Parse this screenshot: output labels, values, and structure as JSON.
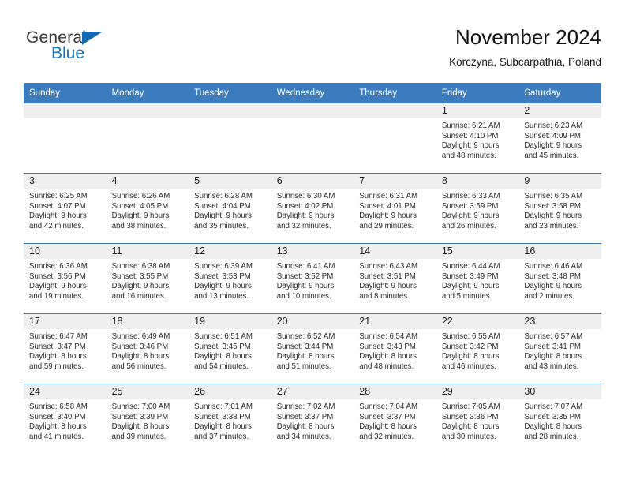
{
  "brand": {
    "name_part1": "General",
    "name_part2": "Blue",
    "triangle_icon": "triangle-icon",
    "accent_blue": "#1577c4"
  },
  "header": {
    "title": "November 2024",
    "subtitle": "Korczyna, Subcarpathia, Poland"
  },
  "theme": {
    "header_bar_color": "#3b7cbe",
    "daynum_band_color": "#efefef",
    "row_divider_color": "#3b7cbe"
  },
  "weekday_headers": [
    "Sunday",
    "Monday",
    "Tuesday",
    "Wednesday",
    "Thursday",
    "Friday",
    "Saturday"
  ],
  "weeks": [
    [
      {
        "day": "",
        "sunrise": "",
        "sunset": "",
        "daylight_a": "",
        "daylight_b": ""
      },
      {
        "day": "",
        "sunrise": "",
        "sunset": "",
        "daylight_a": "",
        "daylight_b": ""
      },
      {
        "day": "",
        "sunrise": "",
        "sunset": "",
        "daylight_a": "",
        "daylight_b": ""
      },
      {
        "day": "",
        "sunrise": "",
        "sunset": "",
        "daylight_a": "",
        "daylight_b": ""
      },
      {
        "day": "",
        "sunrise": "",
        "sunset": "",
        "daylight_a": "",
        "daylight_b": ""
      },
      {
        "day": "1",
        "sunrise": "Sunrise: 6:21 AM",
        "sunset": "Sunset: 4:10 PM",
        "daylight_a": "Daylight: 9 hours",
        "daylight_b": "and 48 minutes."
      },
      {
        "day": "2",
        "sunrise": "Sunrise: 6:23 AM",
        "sunset": "Sunset: 4:09 PM",
        "daylight_a": "Daylight: 9 hours",
        "daylight_b": "and 45 minutes."
      }
    ],
    [
      {
        "day": "3",
        "sunrise": "Sunrise: 6:25 AM",
        "sunset": "Sunset: 4:07 PM",
        "daylight_a": "Daylight: 9 hours",
        "daylight_b": "and 42 minutes."
      },
      {
        "day": "4",
        "sunrise": "Sunrise: 6:26 AM",
        "sunset": "Sunset: 4:05 PM",
        "daylight_a": "Daylight: 9 hours",
        "daylight_b": "and 38 minutes."
      },
      {
        "day": "5",
        "sunrise": "Sunrise: 6:28 AM",
        "sunset": "Sunset: 4:04 PM",
        "daylight_a": "Daylight: 9 hours",
        "daylight_b": "and 35 minutes."
      },
      {
        "day": "6",
        "sunrise": "Sunrise: 6:30 AM",
        "sunset": "Sunset: 4:02 PM",
        "daylight_a": "Daylight: 9 hours",
        "daylight_b": "and 32 minutes."
      },
      {
        "day": "7",
        "sunrise": "Sunrise: 6:31 AM",
        "sunset": "Sunset: 4:01 PM",
        "daylight_a": "Daylight: 9 hours",
        "daylight_b": "and 29 minutes."
      },
      {
        "day": "8",
        "sunrise": "Sunrise: 6:33 AM",
        "sunset": "Sunset: 3:59 PM",
        "daylight_a": "Daylight: 9 hours",
        "daylight_b": "and 26 minutes."
      },
      {
        "day": "9",
        "sunrise": "Sunrise: 6:35 AM",
        "sunset": "Sunset: 3:58 PM",
        "daylight_a": "Daylight: 9 hours",
        "daylight_b": "and 23 minutes."
      }
    ],
    [
      {
        "day": "10",
        "sunrise": "Sunrise: 6:36 AM",
        "sunset": "Sunset: 3:56 PM",
        "daylight_a": "Daylight: 9 hours",
        "daylight_b": "and 19 minutes."
      },
      {
        "day": "11",
        "sunrise": "Sunrise: 6:38 AM",
        "sunset": "Sunset: 3:55 PM",
        "daylight_a": "Daylight: 9 hours",
        "daylight_b": "and 16 minutes."
      },
      {
        "day": "12",
        "sunrise": "Sunrise: 6:39 AM",
        "sunset": "Sunset: 3:53 PM",
        "daylight_a": "Daylight: 9 hours",
        "daylight_b": "and 13 minutes."
      },
      {
        "day": "13",
        "sunrise": "Sunrise: 6:41 AM",
        "sunset": "Sunset: 3:52 PM",
        "daylight_a": "Daylight: 9 hours",
        "daylight_b": "and 10 minutes."
      },
      {
        "day": "14",
        "sunrise": "Sunrise: 6:43 AM",
        "sunset": "Sunset: 3:51 PM",
        "daylight_a": "Daylight: 9 hours",
        "daylight_b": "and 8 minutes."
      },
      {
        "day": "15",
        "sunrise": "Sunrise: 6:44 AM",
        "sunset": "Sunset: 3:49 PM",
        "daylight_a": "Daylight: 9 hours",
        "daylight_b": "and 5 minutes."
      },
      {
        "day": "16",
        "sunrise": "Sunrise: 6:46 AM",
        "sunset": "Sunset: 3:48 PM",
        "daylight_a": "Daylight: 9 hours",
        "daylight_b": "and 2 minutes."
      }
    ],
    [
      {
        "day": "17",
        "sunrise": "Sunrise: 6:47 AM",
        "sunset": "Sunset: 3:47 PM",
        "daylight_a": "Daylight: 8 hours",
        "daylight_b": "and 59 minutes."
      },
      {
        "day": "18",
        "sunrise": "Sunrise: 6:49 AM",
        "sunset": "Sunset: 3:46 PM",
        "daylight_a": "Daylight: 8 hours",
        "daylight_b": "and 56 minutes."
      },
      {
        "day": "19",
        "sunrise": "Sunrise: 6:51 AM",
        "sunset": "Sunset: 3:45 PM",
        "daylight_a": "Daylight: 8 hours",
        "daylight_b": "and 54 minutes."
      },
      {
        "day": "20",
        "sunrise": "Sunrise: 6:52 AM",
        "sunset": "Sunset: 3:44 PM",
        "daylight_a": "Daylight: 8 hours",
        "daylight_b": "and 51 minutes."
      },
      {
        "day": "21",
        "sunrise": "Sunrise: 6:54 AM",
        "sunset": "Sunset: 3:43 PM",
        "daylight_a": "Daylight: 8 hours",
        "daylight_b": "and 48 minutes."
      },
      {
        "day": "22",
        "sunrise": "Sunrise: 6:55 AM",
        "sunset": "Sunset: 3:42 PM",
        "daylight_a": "Daylight: 8 hours",
        "daylight_b": "and 46 minutes."
      },
      {
        "day": "23",
        "sunrise": "Sunrise: 6:57 AM",
        "sunset": "Sunset: 3:41 PM",
        "daylight_a": "Daylight: 8 hours",
        "daylight_b": "and 43 minutes."
      }
    ],
    [
      {
        "day": "24",
        "sunrise": "Sunrise: 6:58 AM",
        "sunset": "Sunset: 3:40 PM",
        "daylight_a": "Daylight: 8 hours",
        "daylight_b": "and 41 minutes."
      },
      {
        "day": "25",
        "sunrise": "Sunrise: 7:00 AM",
        "sunset": "Sunset: 3:39 PM",
        "daylight_a": "Daylight: 8 hours",
        "daylight_b": "and 39 minutes."
      },
      {
        "day": "26",
        "sunrise": "Sunrise: 7:01 AM",
        "sunset": "Sunset: 3:38 PM",
        "daylight_a": "Daylight: 8 hours",
        "daylight_b": "and 37 minutes."
      },
      {
        "day": "27",
        "sunrise": "Sunrise: 7:02 AM",
        "sunset": "Sunset: 3:37 PM",
        "daylight_a": "Daylight: 8 hours",
        "daylight_b": "and 34 minutes."
      },
      {
        "day": "28",
        "sunrise": "Sunrise: 7:04 AM",
        "sunset": "Sunset: 3:37 PM",
        "daylight_a": "Daylight: 8 hours",
        "daylight_b": "and 32 minutes."
      },
      {
        "day": "29",
        "sunrise": "Sunrise: 7:05 AM",
        "sunset": "Sunset: 3:36 PM",
        "daylight_a": "Daylight: 8 hours",
        "daylight_b": "and 30 minutes."
      },
      {
        "day": "30",
        "sunrise": "Sunrise: 7:07 AM",
        "sunset": "Sunset: 3:35 PM",
        "daylight_a": "Daylight: 8 hours",
        "daylight_b": "and 28 minutes."
      }
    ]
  ]
}
